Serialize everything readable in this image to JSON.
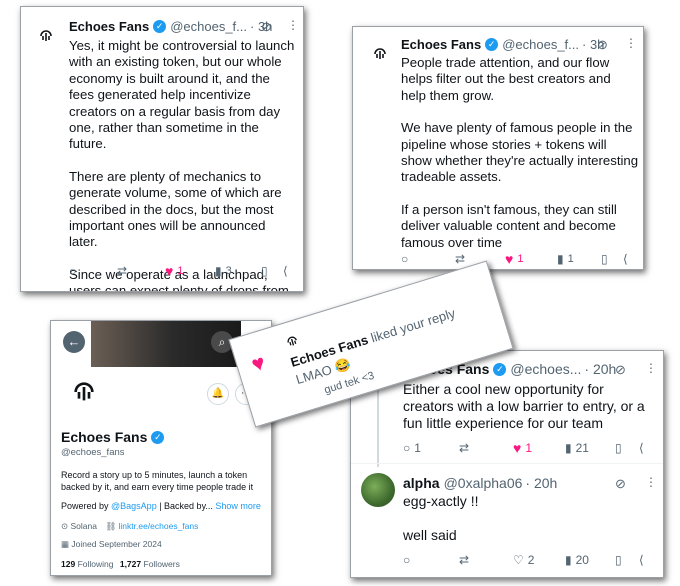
{
  "tweet1": {
    "name": "Echoes Fans",
    "handle": "@echoes_f...",
    "time": "· 3h",
    "paragraphs": [
      "Yes, it might be controversial to launch with an existing token, but our whole economy is built around it, and the fees generated help incentivize creators on a regular basis from day one, rather than sometime in the future.",
      "There are plenty of mechanics to generate volume, some of which are described in the docs, but the most important ones will be announced later.",
      "Since we operate as a launchpad, users can expect plenty of drops from creators"
    ],
    "likes": "1",
    "views": "3"
  },
  "tweet2": {
    "name": "Echoes Fans",
    "handle": "@echoes_f...",
    "time": "· 3h",
    "paragraphs": [
      "People trade attention, and our flow helps filter out the best creators and help them grow.",
      "We have plenty of famous people in the pipeline whose stories + tokens will show whether they're actually interesting tradeable assets.",
      "If a person isn't famous, they can still deliver valuable content and become famous over time"
    ],
    "likes": "1",
    "views": "1"
  },
  "notification": {
    "actor": "Echoes Fans",
    "action": "liked your reply",
    "reply": "LMAO 😂",
    "quoted": "gud tek <3"
  },
  "profile": {
    "name": "Echoes Fans",
    "handle": "@echoes_fans",
    "bio": "Record a story up to 5 minutes, launch a token backed by it, and earn every time people trade it",
    "powered_prefix": "Powered by ",
    "powered_link": "@BagsApp",
    "powered_suffix": " | Backed by... ",
    "show_more": "Show more",
    "location": "Solana",
    "website": "linktr.ee/echoes_fans",
    "joined": "Joined September 2024",
    "following_count": "129",
    "following_label": "Following",
    "followers_count": "1,727",
    "followers_label": "Followers"
  },
  "tweet3": {
    "name": "Echoes Fans",
    "handle": "@echoes...",
    "time": "· 20h",
    "text": "Either a cool new opportunity for creators with a low barrier to entry, or a fun little experience for our team",
    "replies": "1",
    "likes": "1",
    "views": "21"
  },
  "reply": {
    "name": "alpha",
    "handle": "@0xalpha06",
    "time": "· 20h",
    "line1": "egg-xactly !!",
    "line2": "well said",
    "likes": "2",
    "views": "20"
  },
  "icons": {
    "reply": "reply-icon",
    "retweet": "retweet-icon",
    "like": "heart-icon",
    "views": "views-icon",
    "bookmark": "bookmark-icon",
    "share": "share-icon"
  }
}
